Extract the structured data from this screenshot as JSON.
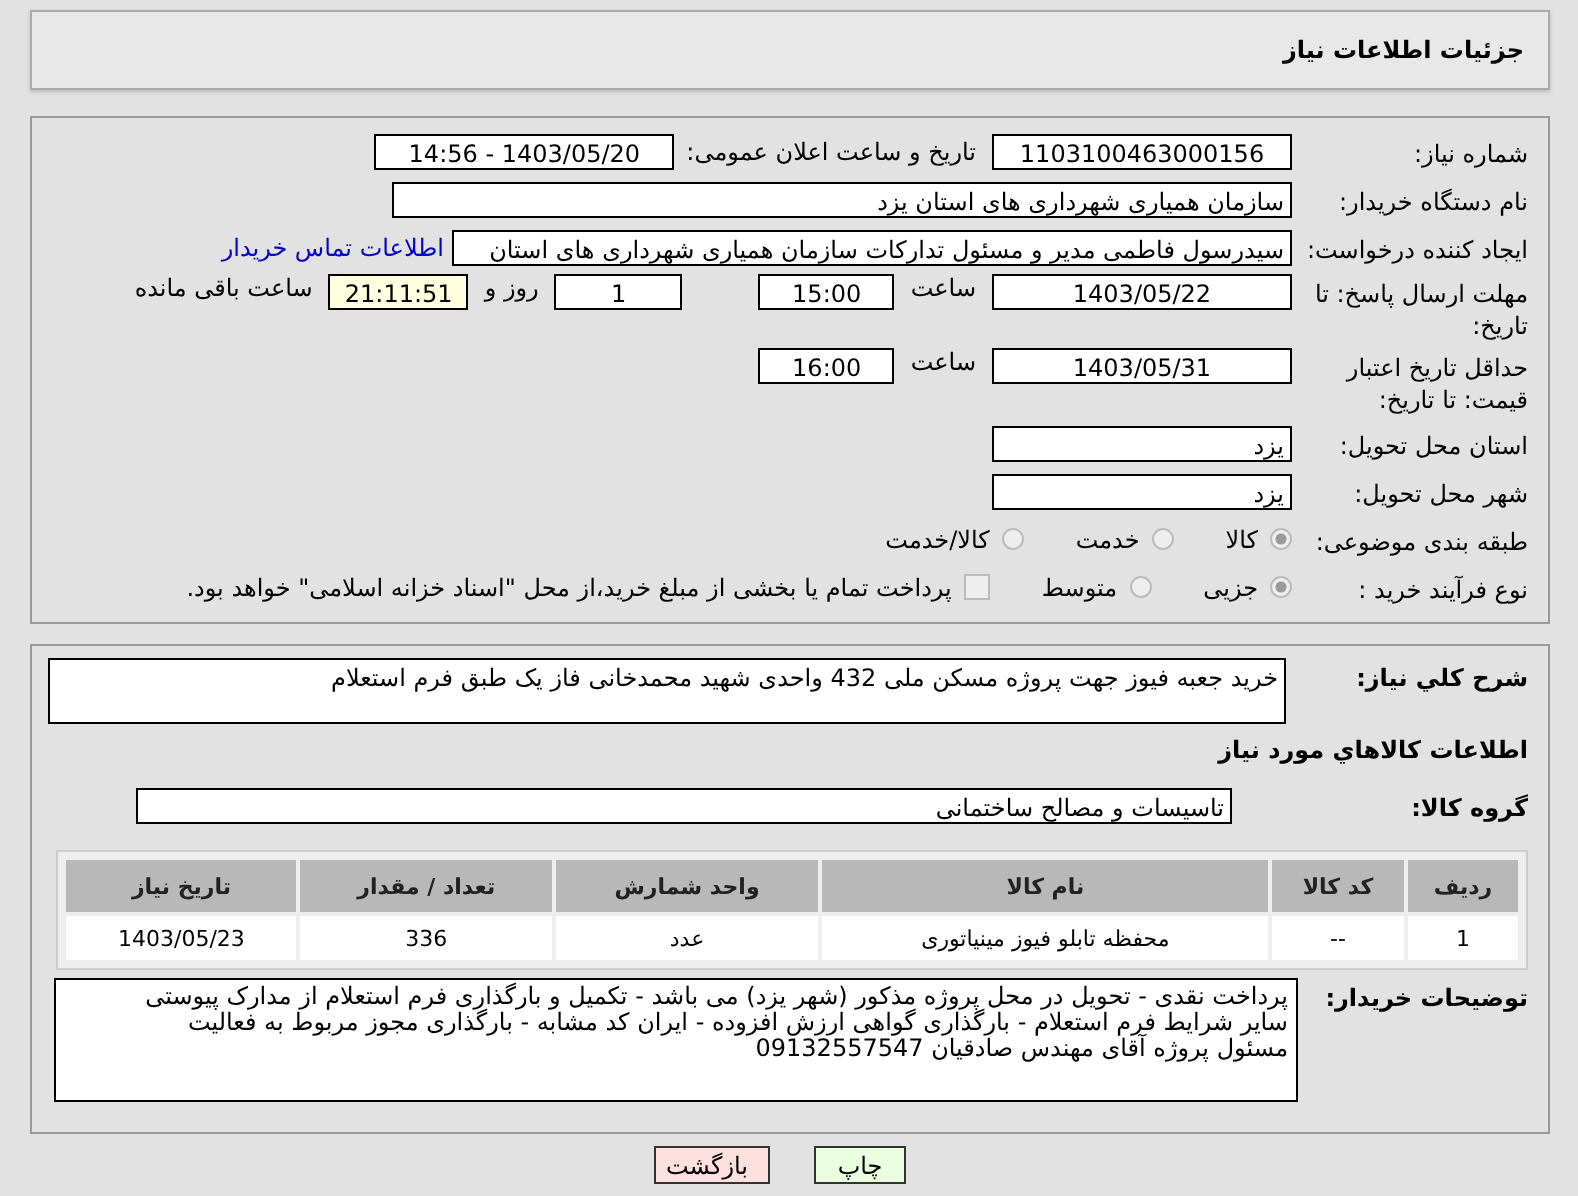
{
  "header": {
    "title": "جزئیات اطلاعات نیاز"
  },
  "details": {
    "need_number": {
      "label": "شماره نیاز:",
      "value": "1103100463000156"
    },
    "announce": {
      "label": "تاریخ و ساعت اعلان عمومی:",
      "value": "1403/05/20 - 14:56"
    },
    "buyer": {
      "label": "نام دستگاه خریدار:",
      "value": "سازمان همیاری شهرداری های استان یزد"
    },
    "requester": {
      "label": "ایجاد کننده درخواست:",
      "value": "سیدرسول فاطمی مدیر و مسئول تدارکات سازمان همیاری شهرداری های استان",
      "link": "اطلاعات تماس خریدار"
    },
    "deadline": {
      "label": "مهلت ارسال پاسخ: تا تاریخ:",
      "date": "1403/05/22",
      "time_label": "ساعت",
      "time": "15:00",
      "days": "1",
      "days_label": "روز و",
      "remaining": "21:11:51",
      "remaining_label": "ساعت باقی مانده"
    },
    "validity": {
      "label": "حداقل تاریخ اعتبار قیمت: تا تاریخ:",
      "date": "1403/05/31",
      "time_label": "ساعت",
      "time": "16:00"
    },
    "province": {
      "label": "استان محل تحویل:",
      "value": "یزد"
    },
    "city": {
      "label": "شهر محل تحویل:",
      "value": "یزد"
    },
    "category": {
      "label": "طبقه بندی موضوعی:",
      "options": [
        {
          "label": "کالا",
          "selected": true
        },
        {
          "label": "خدمت",
          "selected": false
        },
        {
          "label": "کالا/خدمت",
          "selected": false
        }
      ]
    },
    "process": {
      "label": "نوع فرآیند خرید :",
      "options": [
        {
          "label": "جزیی",
          "selected": true
        },
        {
          "label": "متوسط",
          "selected": false
        }
      ],
      "treasury": {
        "checked": false,
        "label": "پرداخت تمام یا بخشی از مبلغ خرید،از محل \"اسناد خزانه اسلامی\" خواهد بود."
      }
    }
  },
  "summary": {
    "label": "شرح کلي نياز:",
    "value": "خرید جعبه فیوز جهت پروژه مسکن ملی 432 واحدی شهید محمدخانی فاز یک طبق فرم استعلام"
  },
  "goods": {
    "heading": "اطلاعات کالاهاي مورد نياز",
    "group_label": "گروه کالا:",
    "group": "تاسیسات و مصالح ساختمانی",
    "columns": [
      "ردیف",
      "کد کالا",
      "نام کالا",
      "واحد شمارش",
      "تعداد / مقدار",
      "تاریخ نیاز"
    ],
    "rows": [
      [
        "1",
        "--",
        "محفظه تابلو فیوز مینیاتوری",
        "عدد",
        "336",
        "1403/05/23"
      ]
    ]
  },
  "notes": {
    "label": "توضیحات خریدار:",
    "lines": [
      "پرداخت نقدی - تحویل در محل پروژه مذکور (شهر یزد) می باشد - تکمیل و بارگذاری فرم استعلام از مدارک پیوستی",
      "سایر شرایط فرم استعلام - بارگذاری گواهی ارزش افزوده - ایران کد مشابه - بارگذاری مجوز مربوط به فعالیت",
      "مسئول پروژه آقای مهندس صادقیان 09132557547"
    ]
  },
  "buttons": [
    {
      "label": "چاپ",
      "kind": "print"
    },
    {
      "label": "بازگشت",
      "kind": "back"
    }
  ]
}
